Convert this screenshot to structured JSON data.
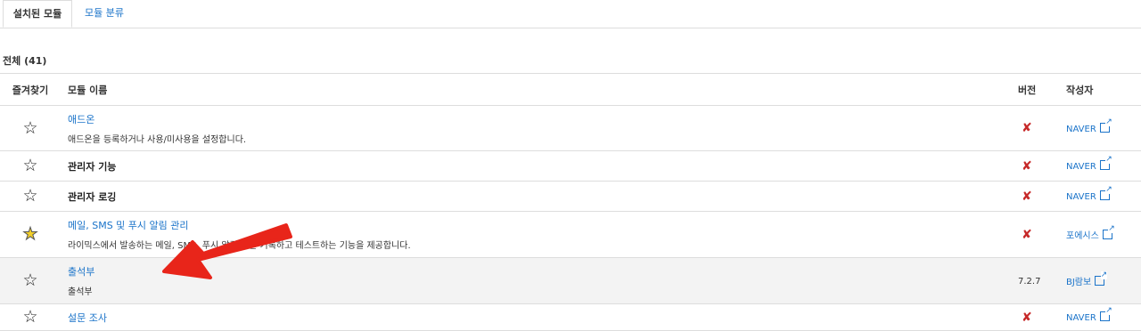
{
  "tabs": {
    "installed": "설치된 모듈",
    "category": "모듈 분류"
  },
  "count_label": "전체 (41)",
  "columns": {
    "favorite": "즐겨찾기",
    "name": "모듈 이름",
    "version": "버전",
    "author": "작성자"
  },
  "rows": [
    {
      "name": "애드온",
      "desc": "애드온을 등록하거나 사용/미사용을 설정합니다.",
      "version": "x",
      "author": "NAVER",
      "starred": false
    },
    {
      "name": "관리자 기능",
      "desc": "",
      "version": "x",
      "author": "NAVER",
      "starred": false
    },
    {
      "name": "관리자 로깅",
      "desc": "",
      "version": "x",
      "author": "NAVER",
      "starred": false
    },
    {
      "name": "메일, SMS 및 푸시 알림 관리",
      "desc": "라이믹스에서 발송하는 메일, SMS, 푸시 알림 등을 기록하고 테스트하는 기능을 제공합니다.",
      "version": "x",
      "author": "포에시스",
      "starred": true
    },
    {
      "name": "출석부",
      "desc": "출석부",
      "version": "7.2.7",
      "author": "BJ람보",
      "starred": false
    },
    {
      "name": "설문 조사",
      "desc": "",
      "version": "x",
      "author": "NAVER",
      "starred": false
    }
  ],
  "icons": {
    "star": "☆",
    "star_filled": "★",
    "invalid": "𝕏",
    "external": "external-link-icon"
  },
  "colors": {
    "link": "#1a73c9",
    "invalid": "#c62828",
    "arrow": "#e8251a",
    "star_on": "#f2cf2a"
  }
}
